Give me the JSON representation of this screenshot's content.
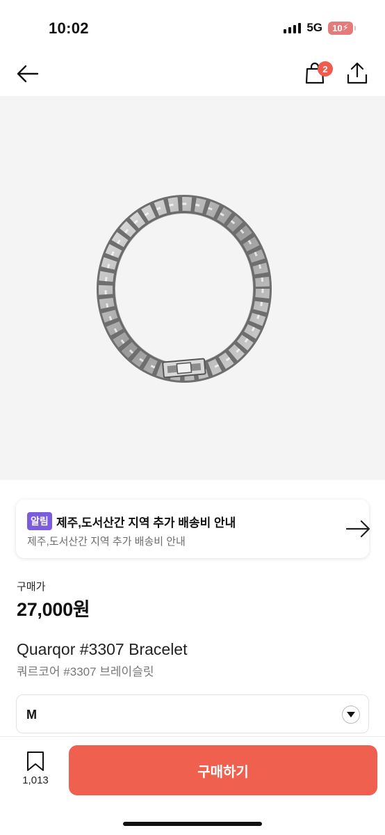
{
  "status_bar": {
    "time": "10:02",
    "network": "5G",
    "battery": "10"
  },
  "header": {
    "cart_count": "2"
  },
  "notice": {
    "tag": "알림",
    "title": "제주,도서산간 지역 추가 배송비 안내",
    "subtitle": "제주,도서산간 지역 추가 배송비 안내"
  },
  "product": {
    "price_label": "구매가",
    "price": "27,000원",
    "name": "Quarqor #3307 Bracelet",
    "name_ko": "쿼르코어 #3307 브레이슬릿"
  },
  "option": {
    "selected": "M"
  },
  "bottom": {
    "bookmark_count": "1,013",
    "buy_label": "구매하기"
  },
  "colors": {
    "accent": "#f0604f",
    "badge": "#ef5b4c",
    "notice_tag": "#7a5cdc",
    "image_bg": "#f4f4f4"
  }
}
